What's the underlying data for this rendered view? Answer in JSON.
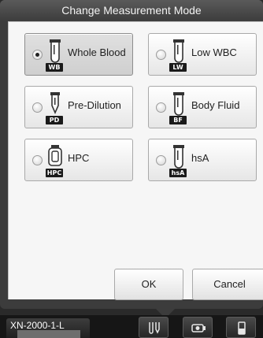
{
  "dialog": {
    "title": "Change Measurement Mode",
    "modes": [
      {
        "label": "Whole Blood",
        "tag": "WB",
        "selected": true,
        "icon": "blood-tube-icon"
      },
      {
        "label": "Low WBC",
        "tag": "LW",
        "selected": false,
        "icon": "blood-tube-icon"
      },
      {
        "label": "Pre-Dilution",
        "tag": "PD",
        "selected": false,
        "icon": "pre-dilution-tube-icon"
      },
      {
        "label": "Body Fluid",
        "tag": "BF",
        "selected": false,
        "icon": "blood-tube-icon"
      },
      {
        "label": "HPC",
        "tag": "HPC",
        "selected": false,
        "icon": "hpc-tube-icon"
      },
      {
        "label": "hsA",
        "tag": "hsA",
        "selected": false,
        "icon": "blood-tube-icon"
      }
    ],
    "ok_label": "OK",
    "cancel_label": "Cancel"
  },
  "taskbar": {
    "instrument_name": "XN-2000-1-L",
    "buttons": [
      {
        "icon": "sample-tube-icon"
      },
      {
        "icon": "sampler-icon"
      },
      {
        "icon": "reagent-icon"
      }
    ]
  },
  "colors": {
    "dialog_frame": "#3c3c3c",
    "dialog_body": "#f6f6f6",
    "taskbar": "#161616"
  }
}
